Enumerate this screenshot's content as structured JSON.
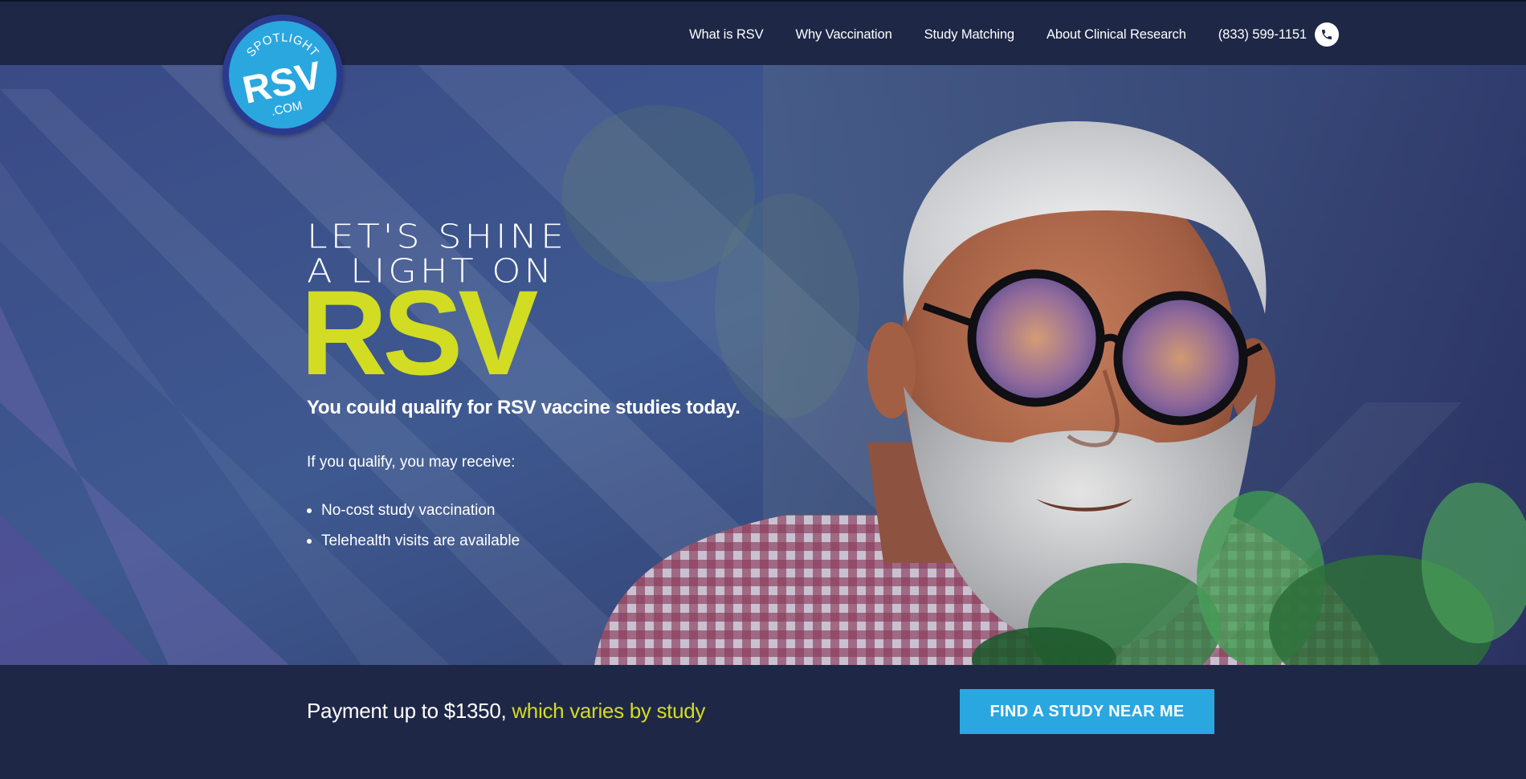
{
  "logo": {
    "line1": "SPOTLIGHT",
    "line2": "RSV",
    "line3": ".COM"
  },
  "nav": {
    "items": [
      {
        "label": "What is RSV"
      },
      {
        "label": "Why Vaccination"
      },
      {
        "label": "Study Matching"
      },
      {
        "label": "About Clinical Research"
      }
    ],
    "phone": "(833) 599-1151",
    "phone_icon": "phone-icon"
  },
  "hero": {
    "headline_line1": "LET'S SHINE",
    "headline_line2": "A LIGHT ON",
    "headline_big": "RSV",
    "subhead": "You could qualify for RSV vaccine studies today.",
    "intro": "If you qualify, you may receive:",
    "benefits": [
      "No-cost study vaccination",
      "Telehealth visits are available"
    ]
  },
  "bar": {
    "payment_main": "Payment up to $1350, ",
    "payment_highlight": "which varies by study",
    "cta_label": "FIND A STUDY NEAR ME"
  },
  "colors": {
    "navy": "#1f2747",
    "accent_yellow": "#d2dc23",
    "accent_blue": "#2aa7df"
  }
}
